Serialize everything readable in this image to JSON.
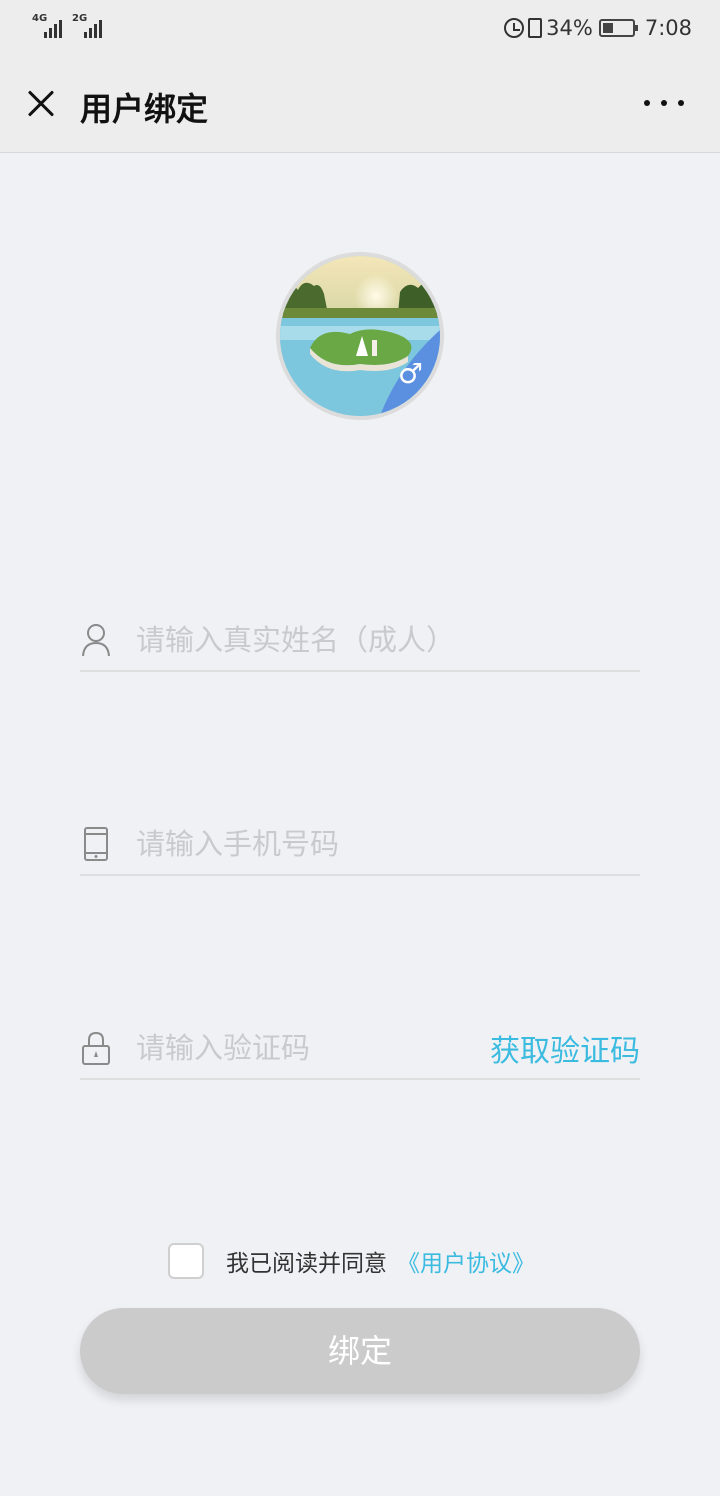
{
  "status_bar": {
    "network_1": "4G",
    "network_2": "2G",
    "battery_percent": "34%",
    "battery_level": 0.34,
    "time": "7:08"
  },
  "nav": {
    "title": "用户绑定"
  },
  "avatar": {
    "gender_symbol": "♂"
  },
  "form": {
    "name_placeholder": "请输入真实姓名（成人）",
    "phone_placeholder": "请输入手机号码",
    "code_placeholder": "请输入验证码",
    "get_code_label": "获取验证码"
  },
  "agreement": {
    "text": "我已阅读并同意",
    "link": "《用户协议》"
  },
  "submit_label": "绑定",
  "colors": {
    "accent": "#3bbbe0",
    "button_disabled": "#cbcbcb",
    "background": "#f0f1f5"
  }
}
